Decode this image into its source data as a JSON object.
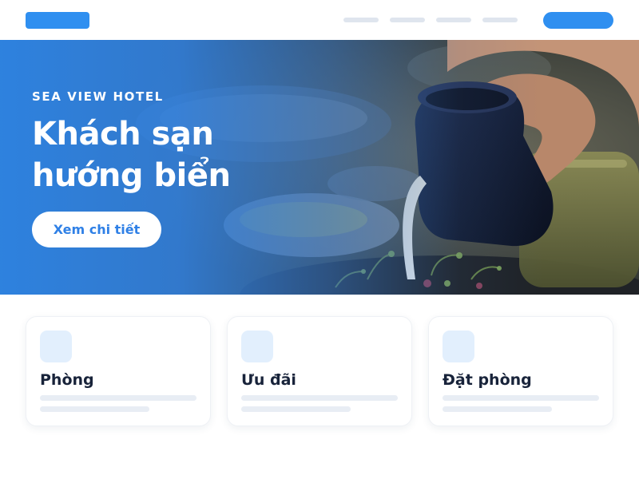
{
  "nav": {
    "links": [
      "",
      "",
      "",
      ""
    ],
    "cta": ""
  },
  "hero": {
    "eyebrow": "SEA VIEW HOTEL",
    "title_line1": "Khách sạn",
    "title_line2": "hướng biển",
    "button": "Xem chi tiết"
  },
  "cards": [
    {
      "title": "Phòng",
      "icon": "room-icon"
    },
    {
      "title": "Ưu đãi",
      "icon": "offer-icon"
    },
    {
      "title": "Đặt phòng",
      "icon": "booking-icon"
    }
  ],
  "colors": {
    "accent": "#2f8ff0",
    "card_icon_bg": "#e2effd",
    "title_text": "#18233a",
    "placeholder": "#dfe5ee"
  }
}
